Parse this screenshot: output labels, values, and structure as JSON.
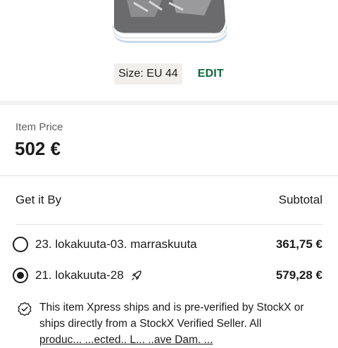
{
  "product": {
    "size_chip": "Size: EU 44",
    "edit_label": "EDIT"
  },
  "price": {
    "label": "Item Price",
    "value": "502 €"
  },
  "delivery": {
    "header_left": "Get it By",
    "header_right": "Subtotal",
    "options": [
      {
        "label": "23. lokakuuta-03. marraskuuta",
        "price": "361,75 €",
        "selected": false
      },
      {
        "label": "21. lokakuuta-28",
        "price": "579,28 €",
        "selected": true,
        "icon": "rocket-icon"
      }
    ]
  },
  "info": {
    "text": "This item Xpress ships and is pre-verified by StockX or ships directly from a StockX Verified Seller. All",
    "text_cut": "produc... ...ected..  L... ..ave Dam. ..."
  },
  "colors": {
    "accent": "#0e6b3f",
    "text": "#1b1b1b",
    "muted": "#5e5e5e"
  }
}
